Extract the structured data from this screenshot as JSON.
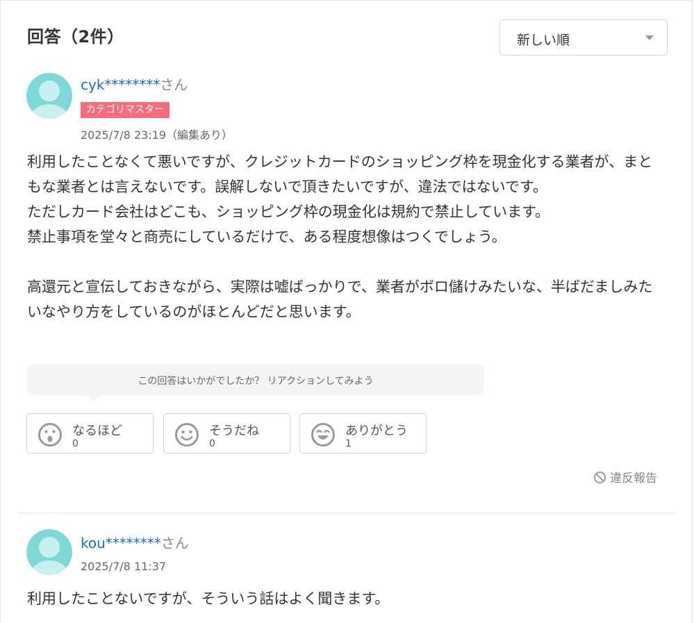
{
  "header": {
    "title": "回答（2件）"
  },
  "sort": {
    "selected": "新しい順"
  },
  "answers": [
    {
      "user_name": "cyk********",
      "user_suffix": "さん",
      "badge": "カテゴリマスター",
      "timestamp": "2025/7/8 23:19（編集あり）",
      "body": [
        "利用したことなくて悪いですが、クレジットカードのショッピング枠を現金化する業者が、まともな業者とは言えないです。誤解しないで頂きたいですが、違法ではないです。\nただしカード会社はどこも、ショッピング枠の現金化は規約で禁止しています。\n禁止事項を堂々と商売にしているだけで、ある程度想像はつくでしょう。",
        "高還元と宣伝しておきながら、実際は嘘ばっかりで、業者がボロ儲けみたいな、半ばだましみたいなやり方をしているのがほとんどだと思います。"
      ],
      "reaction_prompt": "この回答はいかがでしたか？ リアクションしてみよう",
      "reactions": [
        {
          "label": "なるほど",
          "count": "0",
          "icon": "surprised-face-icon"
        },
        {
          "label": "そうだね",
          "count": "0",
          "icon": "smile-face-icon"
        },
        {
          "label": "ありがとう",
          "count": "1",
          "icon": "grin-face-icon"
        }
      ],
      "report_label": "違反報告"
    },
    {
      "user_name": "kou********",
      "user_suffix": "さん",
      "timestamp": "2025/7/8 11:37",
      "body": [
        "利用したことないですが、そういう話はよく聞きます。"
      ]
    }
  ],
  "colors": {
    "link": "#1a6ec2",
    "badge": "#f86b7d",
    "avatar": "#7fd8d8",
    "avatar_light": "#c6f1f0"
  }
}
